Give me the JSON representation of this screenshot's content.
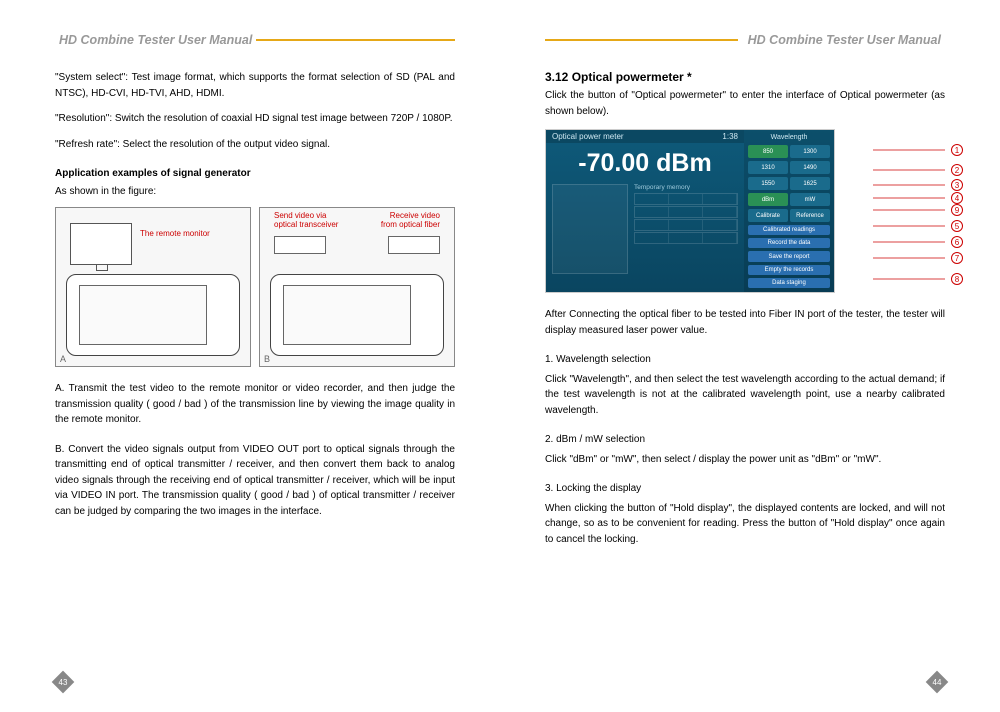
{
  "header_title": "HD Combine Tester User Manual",
  "left": {
    "p1": "\"System select\": Test image format, which supports the format selection of SD (PAL and NTSC), HD-CVI, HD-TVI, AHD, HDMI.",
    "p2": "\"Resolution\": Switch the resolution of coaxial HD signal test image between 720P / 1080P.",
    "p3": "\"Refresh rate\": Select the resolution of the output video signal.",
    "app_title": "Application examples of signal generator",
    "app_intro": "As shown in the figure:",
    "fig_a_label": "The remote monitor",
    "fig_b_label1": "Send video via optical transceiver",
    "fig_b_label2": "Receive video from optical fiber",
    "fig_a": "A",
    "fig_b": "B",
    "pa": "A. Transmit the test video to the remote monitor or video recorder, and then judge the transmission quality ( good / bad ) of the transmission line by viewing the image quality in the remote monitor.",
    "pb": "B. Convert the video signals output from VIDEO OUT port to optical signals through the transmitting end of optical transmitter / receiver, and then convert them back to analog video signals through the receiving end of optical transmitter / receiver, which will be input via VIDEO IN port. The transmission quality ( good / bad ) of optical transmitter / receiver can be judged by comparing the two images in the interface.",
    "page_num": "43"
  },
  "right": {
    "section": "3.12 Optical powermeter *",
    "intro": "Click the button of \"Optical powermeter\" to enter the interface of Optical powermeter (as shown below).",
    "opm": {
      "title": "Optical power meter",
      "time": "1:38",
      "wl_label": "Wavelength",
      "value": "-70.00 dBm",
      "mem_title": "Temporary memory",
      "btns": {
        "b850": "850",
        "b1300": "1300",
        "b1310": "1310",
        "b1490": "1490",
        "b1550": "1550",
        "b1625": "1625",
        "dbm": "dBm",
        "mw": "mW",
        "calib": "Calibrate",
        "ref": "Reference",
        "calrd": "Calibrated readings",
        "rec": "Record the data",
        "save": "Save the report",
        "empty": "Empty the records",
        "stage": "Data staging"
      }
    },
    "after": "After Connecting the optical fiber to be tested into Fiber IN port of the tester, the tester will display measured laser power value.",
    "s1t": "1. Wavelength selection",
    "s1": "Click \"Wavelength\", and then select the test wavelength according to the actual demand; if the test wavelength is not at the calibrated wavelength point, use a nearby calibrated wavelength.",
    "s2t": "2. dBm / mW selection",
    "s2": "Click \"dBm\" or \"mW\", then select / display the power unit as \"dBm\" or \"mW\".",
    "s3t": "3. Locking the display",
    "s3": "When clicking the button of \"Hold display\", the displayed contents are locked, and will not change, so as to be convenient for reading. Press the button of \"Hold display\" once again to cancel the locking.",
    "page_num": "44",
    "callouts": [
      "1",
      "2",
      "3",
      "4",
      "9",
      "5",
      "6",
      "7",
      "8"
    ]
  }
}
